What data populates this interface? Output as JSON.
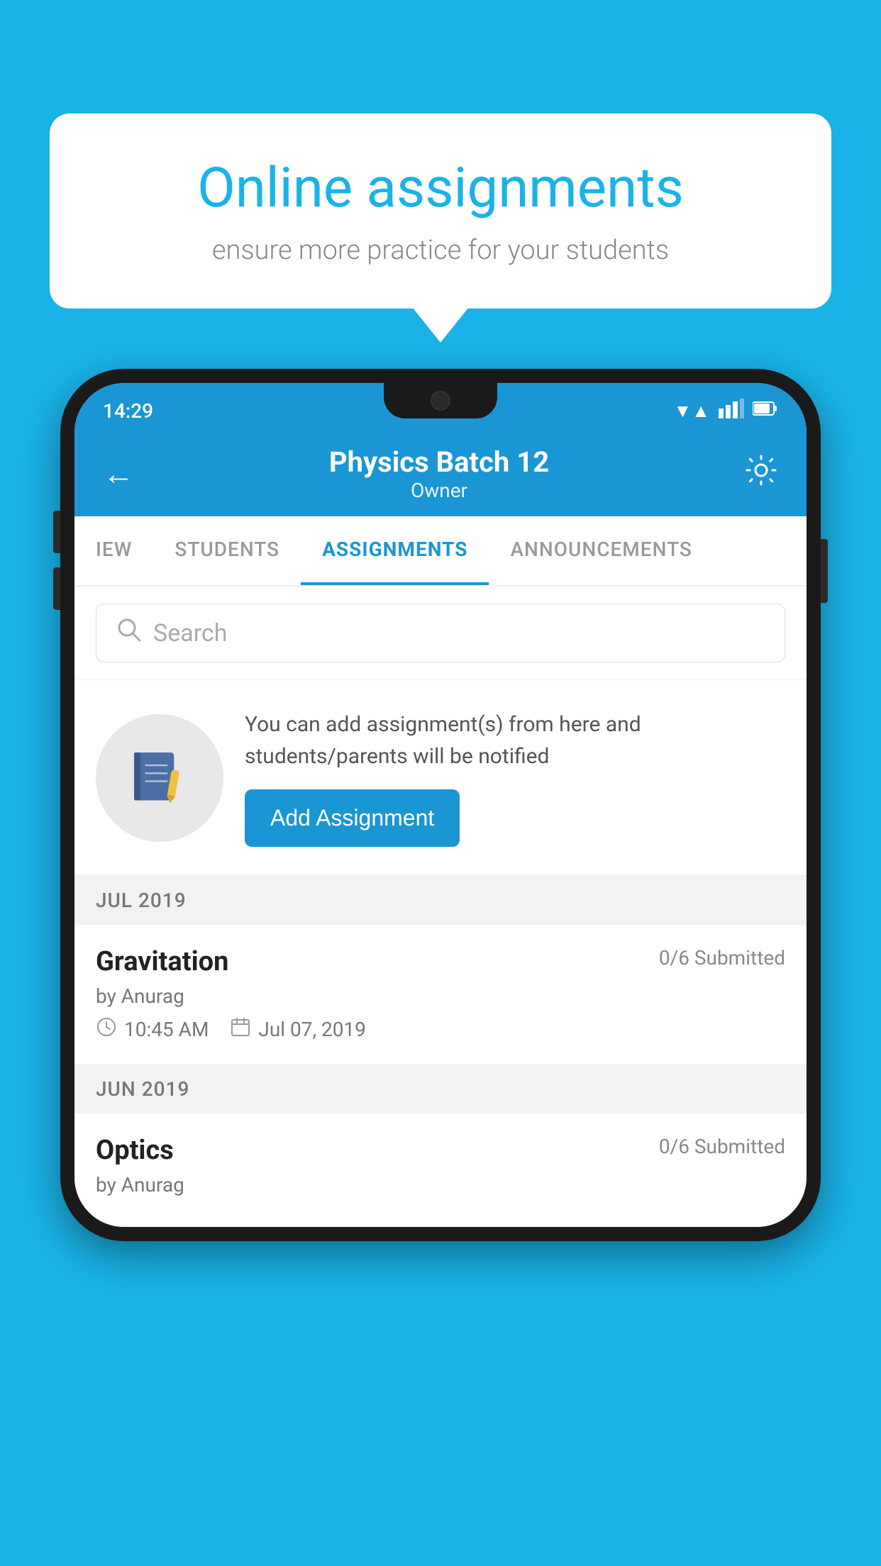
{
  "background": {
    "color": "#1AB3E8"
  },
  "speech_bubble": {
    "title": "Online assignments",
    "subtitle": "ensure more practice for your students"
  },
  "phone": {
    "status_bar": {
      "time": "14:29",
      "wifi": "▼▲",
      "signal": "▲▲",
      "battery": "▮"
    },
    "header": {
      "back_label": "←",
      "title": "Physics Batch 12",
      "subtitle": "Owner",
      "settings_label": "⚙"
    },
    "tabs": [
      {
        "label": "IEW",
        "active": false
      },
      {
        "label": "STUDENTS",
        "active": false
      },
      {
        "label": "ASSIGNMENTS",
        "active": true
      },
      {
        "label": "ANNOUNCEMENTS",
        "active": false
      }
    ],
    "search": {
      "placeholder": "Search"
    },
    "info_card": {
      "description": "You can add assignment(s) from here and students/parents will be notified",
      "button_label": "Add Assignment"
    },
    "assignment_groups": [
      {
        "month": "JUL 2019",
        "assignments": [
          {
            "name": "Gravitation",
            "submitted": "0/6 Submitted",
            "by": "by Anurag",
            "time": "10:45 AM",
            "date": "Jul 07, 2019"
          }
        ]
      },
      {
        "month": "JUN 2019",
        "assignments": [
          {
            "name": "Optics",
            "submitted": "0/6 Submitted",
            "by": "by Anurag",
            "time": "",
            "date": ""
          }
        ]
      }
    ]
  }
}
